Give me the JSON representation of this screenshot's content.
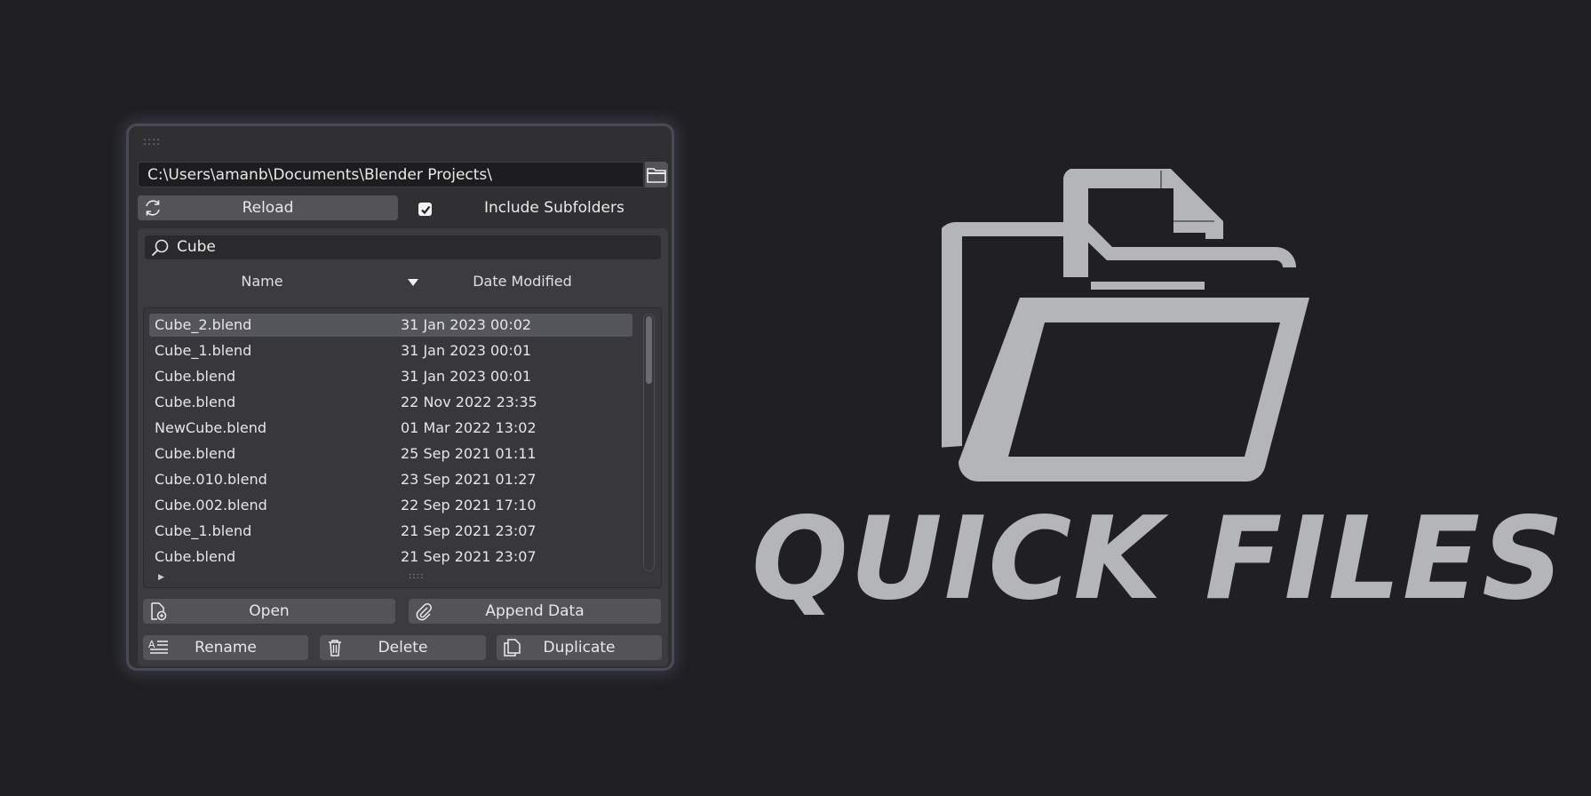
{
  "panel": {
    "grip": "::::",
    "path": "C:\\Users\\amanb\\Documents\\Blender Projects\\",
    "reload_label": "Reload",
    "include_subfolders_label": "Include Subfolders",
    "include_subfolders_checked": true,
    "search_value": "Cube",
    "columns": {
      "name": "Name",
      "date": "Date Modified"
    },
    "files": [
      {
        "name": "Cube_2.blend",
        "date": "31 Jan 2023 00:02",
        "selected": true
      },
      {
        "name": "Cube_1.blend",
        "date": "31 Jan 2023 00:01"
      },
      {
        "name": "Cube.blend",
        "date": "31 Jan 2023 00:01"
      },
      {
        "name": "Cube.blend",
        "date": "22 Nov 2022 23:35"
      },
      {
        "name": "NewCube.blend",
        "date": "01 Mar 2022 13:02"
      },
      {
        "name": "Cube.blend",
        "date": "25 Sep 2021 01:11"
      },
      {
        "name": "Cube.010.blend",
        "date": "23 Sep 2021 01:27"
      },
      {
        "name": "Cube.002.blend",
        "date": "22 Sep 2021 17:10"
      },
      {
        "name": "Cube_1.blend",
        "date": "21 Sep 2021 23:07"
      },
      {
        "name": "Cube.blend",
        "date": "21 Sep 2021 23:07"
      }
    ],
    "list_grip": "::::",
    "buttons": {
      "open": "Open",
      "append": "Append Data",
      "rename": "Rename",
      "delete": "Delete",
      "duplicate": "Duplicate"
    }
  },
  "brand": {
    "title": "QUICK FILES"
  },
  "icons": [
    "folder-icon",
    "reload-icon",
    "checkmark-icon",
    "search-icon",
    "sort-down-icon",
    "open-file-icon",
    "paperclip-icon",
    "rename-icon",
    "trash-icon",
    "duplicate-icon",
    "quick-files-logo-icon"
  ],
  "colors": {
    "background": "#202023",
    "panel": "#303033",
    "button": "#545458",
    "brand": "#b4b5b9"
  }
}
